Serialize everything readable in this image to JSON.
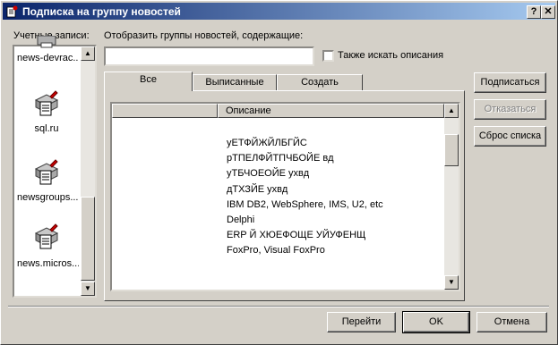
{
  "window": {
    "title": "Подписка на группу новостей",
    "help_btn": "?",
    "close_btn": "✕"
  },
  "accounts": {
    "label": "Учетные записи:",
    "items": [
      {
        "label": "news-devrac..."
      },
      {
        "label": "sql.ru"
      },
      {
        "label": "newsgroups...."
      },
      {
        "label": "news.micros..."
      }
    ]
  },
  "filter": {
    "label": "Отобразить группы новостей, содержащие:",
    "value": "",
    "also_desc_label": "Также искать описания",
    "also_desc_checked": false
  },
  "tabs": [
    {
      "label": "Все"
    },
    {
      "label": "Выписанные"
    },
    {
      "label": "Создать"
    }
  ],
  "grid": {
    "columns": [
      "",
      "Описание"
    ],
    "descriptions": [
      "уЕТФЙЖЙЛБГЙС",
      "рТПЕЛФЙТПЧБОЙЕ вд",
      "уТБЧОЕОЙЕ ухвд",
      "дТХЗЙЕ ухвд",
      "IBM DB2, WebSphere, IMS, U2, etc",
      "Delphi",
      "ERP Й ХЮЕФОЩЕ УЙУФЕНЩ",
      "FoxPro, Visual FoxPro"
    ]
  },
  "side_buttons": {
    "subscribe": "Подписаться",
    "unsubscribe": "Отказаться",
    "reset": "Сброс списка"
  },
  "bottom_buttons": {
    "goto": "Перейти",
    "ok": "OK",
    "cancel": "Отмена"
  }
}
